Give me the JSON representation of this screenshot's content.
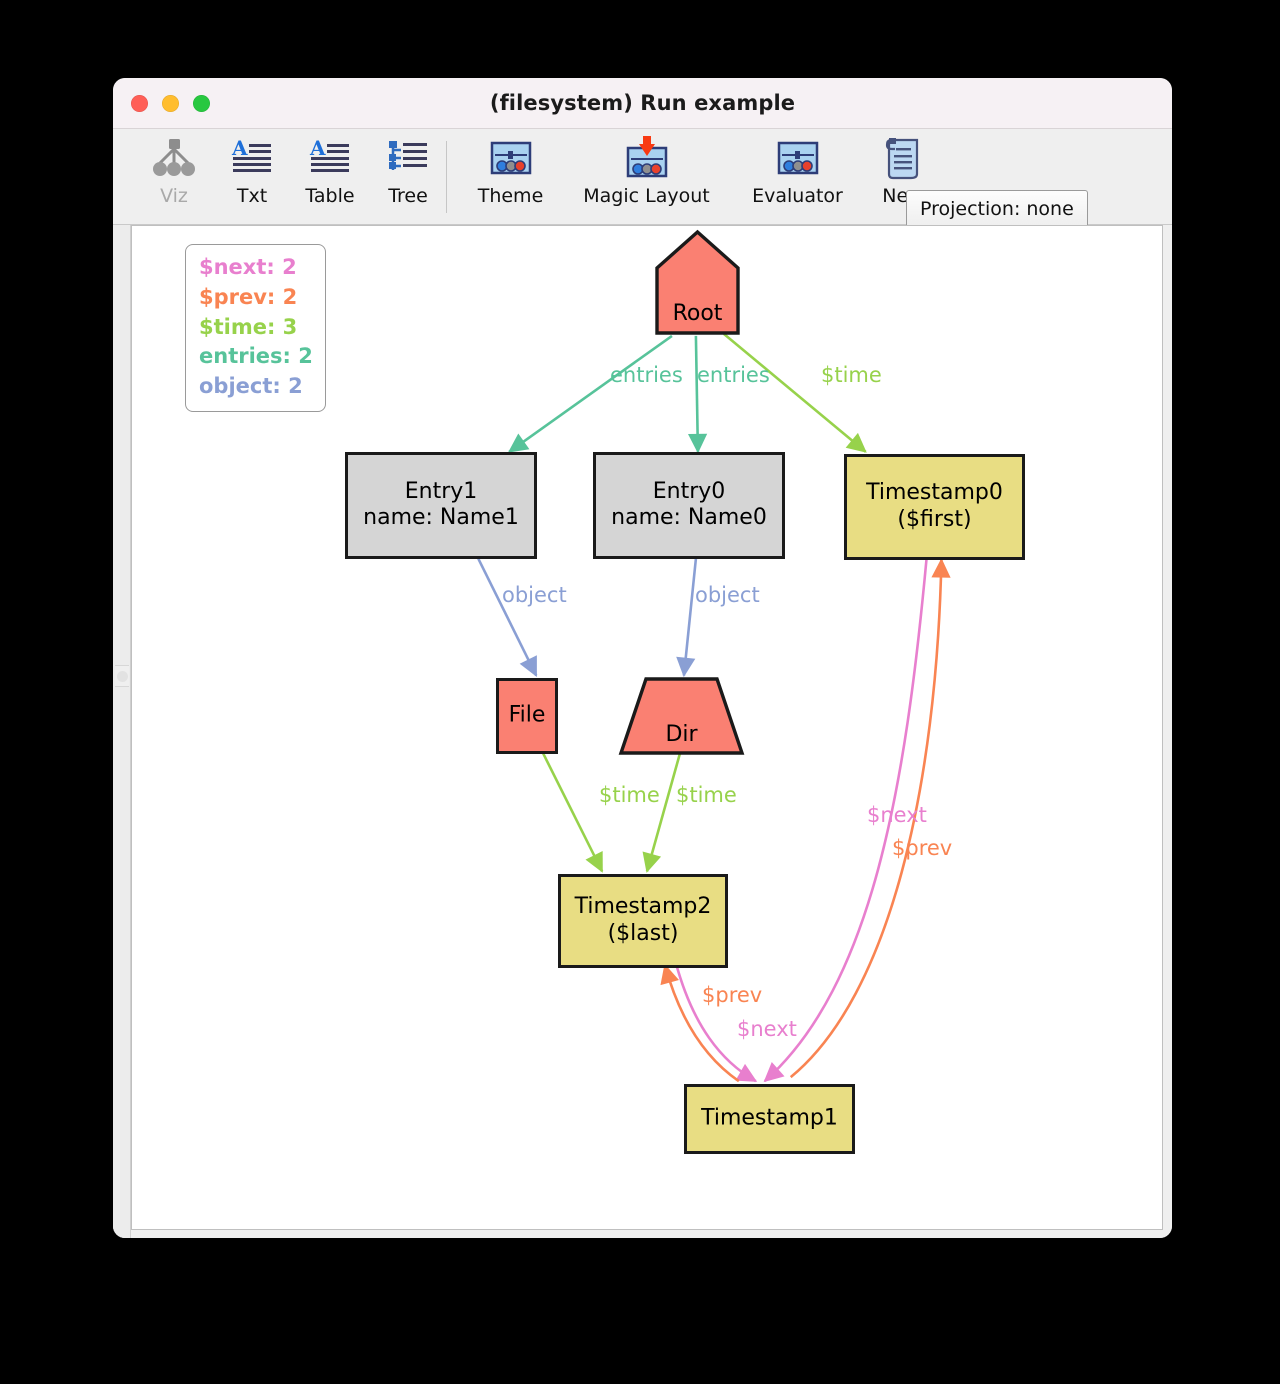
{
  "window": {
    "title": "(filesystem) Run example",
    "traffic_lights": [
      "close-button",
      "minimize-button",
      "maximize-button"
    ]
  },
  "toolbar": {
    "left_items": [
      {
        "label": "Viz",
        "icon": "graph-viz-icon",
        "disabled": true
      },
      {
        "label": "Txt",
        "icon": "text-lines-icon",
        "disabled": false
      },
      {
        "label": "Table",
        "icon": "text-lines-icon",
        "disabled": false
      },
      {
        "label": "Tree",
        "icon": "tree-list-icon",
        "disabled": false
      }
    ],
    "right_items": [
      {
        "label": "Theme",
        "icon": "sliders-panel-icon",
        "disabled": false
      },
      {
        "label": "Magic Layout",
        "icon": "sliders-panel-arrow-icon",
        "disabled": false
      },
      {
        "label": "Evaluator",
        "icon": "sliders-panel-icon",
        "disabled": false
      },
      {
        "label": "New",
        "icon": "scroll-document-icon",
        "disabled": false
      }
    ],
    "projection_button": "Projection: none"
  },
  "legend": {
    "items": [
      {
        "label": "$next: 2",
        "color": "#e87fce"
      },
      {
        "label": "$prev: 2",
        "color": "#f98452"
      },
      {
        "label": "$time: 3",
        "color": "#97d24b"
      },
      {
        "label": "entries: 2",
        "color": "#57c39a"
      },
      {
        "label": "object: 2",
        "color": "#8a9fd4"
      }
    ]
  },
  "graph": {
    "nodes": [
      {
        "id": "root",
        "label": "Root",
        "shape": "house",
        "fill": "#fa8072"
      },
      {
        "id": "entry1",
        "label": "Entry1\nname: Name1",
        "shape": "rect",
        "fill": "#d5d5d5"
      },
      {
        "id": "entry0",
        "label": "Entry0\nname: Name0",
        "shape": "rect",
        "fill": "#d5d5d5"
      },
      {
        "id": "timestamp0",
        "label": "Timestamp0\n($first)",
        "shape": "rect",
        "fill": "#e8dd83"
      },
      {
        "id": "file",
        "label": "File",
        "shape": "rect",
        "fill": "#fa8072"
      },
      {
        "id": "dir",
        "label": "Dir",
        "shape": "trapezoid",
        "fill": "#fa8072"
      },
      {
        "id": "timestamp2",
        "label": "Timestamp2\n($last)",
        "shape": "rect",
        "fill": "#e8dd83"
      },
      {
        "id": "timestamp1",
        "label": "Timestamp1",
        "shape": "rect",
        "fill": "#e8dd83"
      }
    ],
    "edges": [
      {
        "from": "root",
        "to": "entry1",
        "label": "entries",
        "color": "#57c39a"
      },
      {
        "from": "root",
        "to": "entry0",
        "label": "entries",
        "color": "#57c39a"
      },
      {
        "from": "root",
        "to": "timestamp0",
        "label": "$time",
        "color": "#97d24b"
      },
      {
        "from": "entry1",
        "to": "file",
        "label": "object",
        "color": "#8a9fd4"
      },
      {
        "from": "entry0",
        "to": "dir",
        "label": "object",
        "color": "#8a9fd4"
      },
      {
        "from": "file",
        "to": "timestamp2",
        "label": "$time",
        "color": "#97d24b"
      },
      {
        "from": "dir",
        "to": "timestamp2",
        "label": "$time",
        "color": "#97d24b"
      },
      {
        "from": "timestamp0",
        "to": "timestamp1",
        "label": "$next",
        "color": "#e87fce"
      },
      {
        "from": "timestamp1",
        "to": "timestamp0",
        "label": "$prev",
        "color": "#f98452"
      },
      {
        "from": "timestamp2",
        "to": "timestamp1",
        "label": "$next",
        "color": "#e87fce"
      },
      {
        "from": "timestamp1",
        "to": "timestamp2",
        "label": "$prev",
        "color": "#f98452"
      }
    ]
  }
}
